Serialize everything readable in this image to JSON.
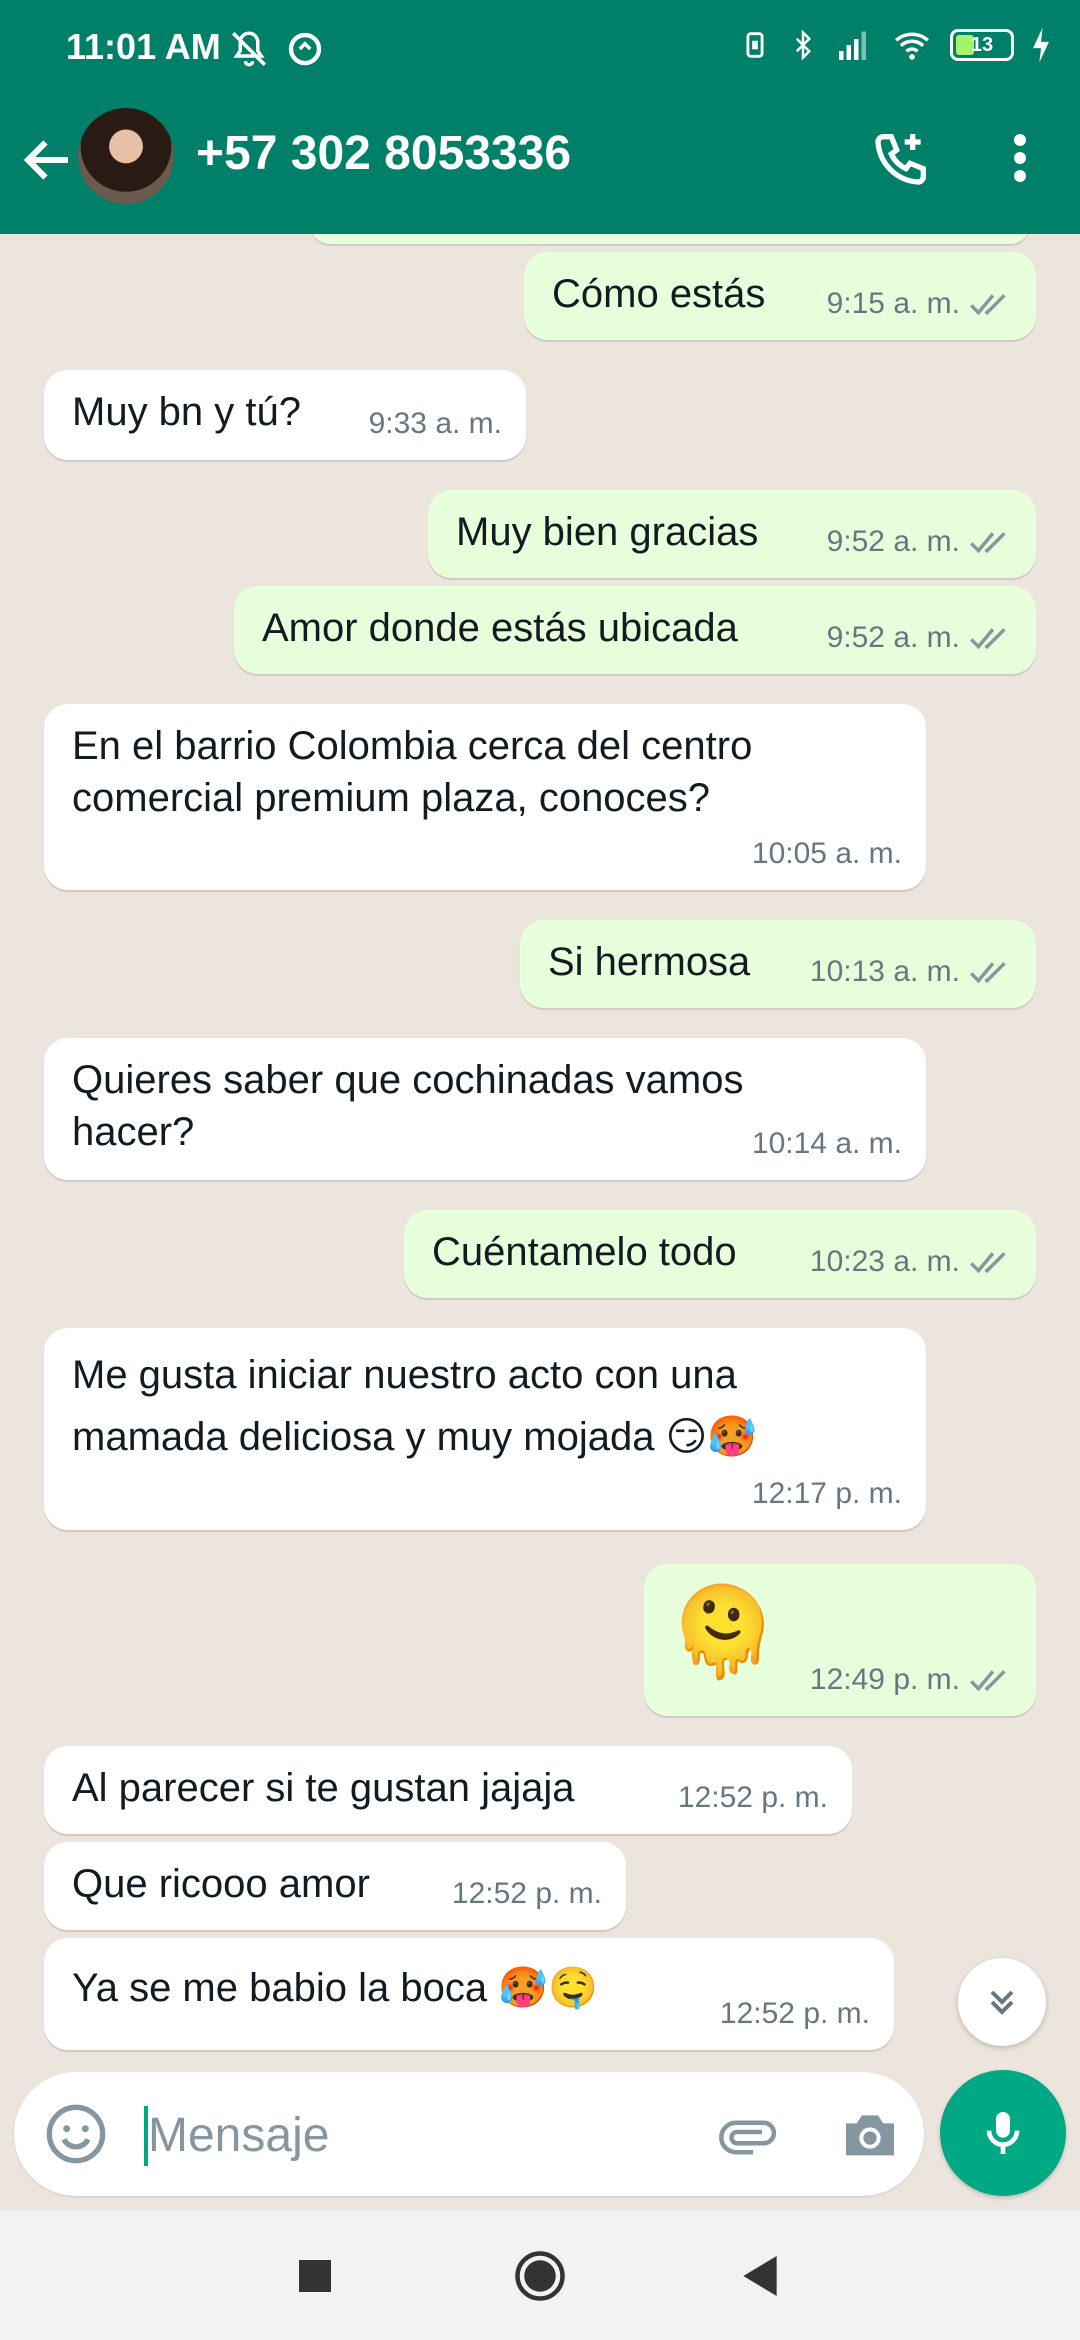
{
  "status_bar": {
    "time": "11:01 AM",
    "battery_level": "13",
    "icons": [
      "mute-icon",
      "data-saver-icon",
      "vibrate-icon",
      "bluetooth-icon",
      "signal-icon",
      "wifi-icon",
      "battery-icon",
      "charging-icon"
    ]
  },
  "header": {
    "contact_name": "+57 302 8053336",
    "icons": [
      "back-arrow-icon",
      "add-call-icon",
      "more-vert-icon"
    ]
  },
  "messages": [
    {
      "dir": "out",
      "text": "Cómo estás",
      "time": "9:15 a. m."
    },
    {
      "dir": "in",
      "text": "Muy bn y tú?",
      "time": "9:33 a. m."
    },
    {
      "dir": "out",
      "text": "Muy bien gracias",
      "time": "9:52 a. m."
    },
    {
      "dir": "out",
      "text": "Amor donde estás ubicada",
      "time": "9:52 a. m."
    },
    {
      "dir": "in",
      "text": "En el barrio Colombia cerca del centro\ncomercial premium plaza, conoces?",
      "time": "10:05 a. m."
    },
    {
      "dir": "out",
      "text": "Si hermosa",
      "time": "10:13 a. m."
    },
    {
      "dir": "in",
      "text": "Quieres saber que cochinadas vamos\nhacer?",
      "time": "10:14 a. m."
    },
    {
      "dir": "out",
      "text": "Cuéntamelo todo",
      "time": "10:23 a. m."
    },
    {
      "dir": "in",
      "text": "Me gusta iniciar nuestro acto con una\nmamada deliciosa y muy mojada 😏🥵",
      "time": "12:17 p. m."
    },
    {
      "dir": "out",
      "text": "🫠",
      "time": "12:49 p. m."
    },
    {
      "dir": "in",
      "text": "Al parecer si te gustan jajaja",
      "time": "12:52 p. m."
    },
    {
      "dir": "in",
      "text": "Que ricooo amor",
      "time": "12:52 p. m."
    },
    {
      "dir": "in",
      "text": "Ya se me babio la boca 🥵🤤",
      "time": "12:52 p. m."
    }
  ],
  "composer": {
    "placeholder": "Mensaje",
    "icons": [
      "emoji-icon",
      "attach-icon",
      "camera-icon",
      "mic-icon"
    ]
  },
  "colors": {
    "header": "#008069",
    "outgoing_bubble": "#e7ffdb",
    "incoming_bubble": "#ffffff",
    "background": "#ece5dd",
    "accent": "#00a884",
    "read_ticks": "#8696a0"
  }
}
